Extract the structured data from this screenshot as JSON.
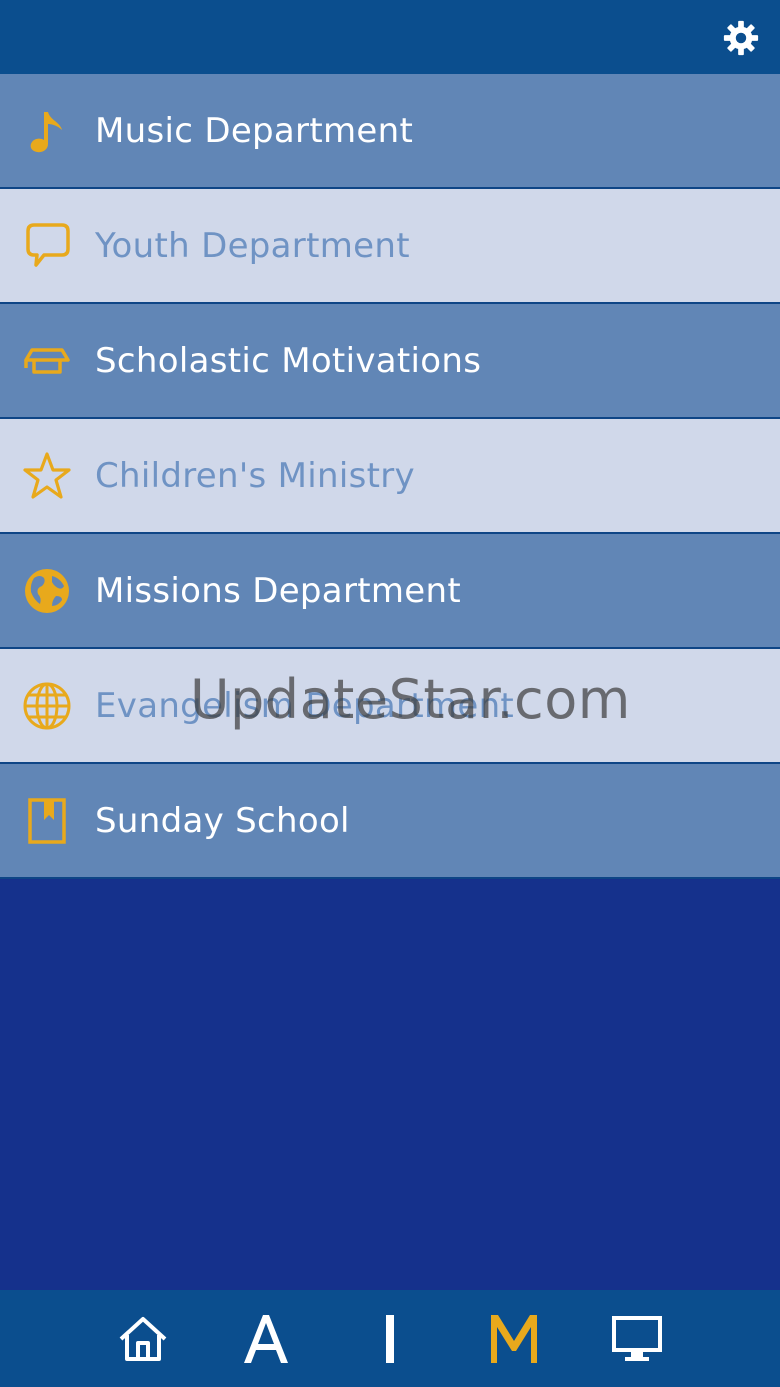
{
  "header": {
    "settings_icon": "gear-icon"
  },
  "menu": {
    "items": [
      {
        "label": "Music Department",
        "icon": "music-note-icon",
        "style": "dark"
      },
      {
        "label": "Youth Department",
        "icon": "speech-bubble-icon",
        "style": "light"
      },
      {
        "label": "Scholastic Motivations",
        "icon": "graduation-cap-icon",
        "style": "dark"
      },
      {
        "label": "Children's Ministry",
        "icon": "star-icon",
        "style": "light"
      },
      {
        "label": "Missions Department",
        "icon": "earth-icon",
        "style": "dark"
      },
      {
        "label": "Evangelism Department",
        "icon": "globe-grid-icon",
        "style": "light"
      },
      {
        "label": "Sunday School",
        "icon": "bookmark-book-icon",
        "style": "dark"
      }
    ]
  },
  "watermark": "UpdateStar.com",
  "tabbar": {
    "tabs": [
      {
        "icon": "home-icon"
      },
      {
        "label": "A"
      },
      {
        "label": "I"
      },
      {
        "label": "M",
        "active": true
      },
      {
        "icon": "monitor-icon"
      }
    ]
  },
  "colors": {
    "header": "#0b4e8e",
    "row_dark": "#6186b6",
    "row_light": "#d0d8ea",
    "background": "#15318c",
    "icon_accent": "#e8a91c"
  }
}
